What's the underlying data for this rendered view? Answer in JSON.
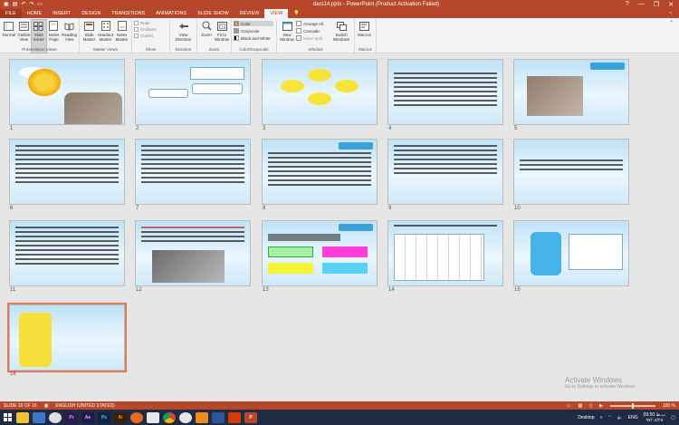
{
  "titlebar": {
    "title": "dars14.pptx - PowerPoint (Product Activation Failed)",
    "minimize": "—",
    "restore": "❐",
    "close": "✕"
  },
  "tabs": {
    "file": "FILE",
    "items": [
      "HOME",
      "INSERT",
      "DESIGN",
      "TRANSITIONS",
      "ANIMATIONS",
      "SLIDE SHOW",
      "REVIEW",
      "VIEW"
    ],
    "active": "VIEW"
  },
  "ribbon": {
    "presentation_views": {
      "label": "Presentation Views",
      "buttons": [
        "Normal",
        "Outline View",
        "Slide Sorter",
        "Notes Page",
        "Reading View"
      ]
    },
    "master_views": {
      "label": "Master Views",
      "buttons": [
        "Slide Master",
        "Handout Master",
        "Notes Master"
      ]
    },
    "show": {
      "label": "Show",
      "items": [
        "Ruler",
        "Gridlines",
        "Guides"
      ]
    },
    "direction": {
      "label": "Direction",
      "button": "View Direction"
    },
    "zoom": {
      "label": "Zoom",
      "buttons": [
        "Zoom",
        "Fit to Window"
      ]
    },
    "color": {
      "label": "Color/Grayscale",
      "items": [
        "Color",
        "Grayscale",
        "Black and White"
      ]
    },
    "window": {
      "label": "Window",
      "new_window": "New Window",
      "items": [
        "Arrange All",
        "Cascade",
        "Move Split"
      ],
      "switch": "Switch Windows"
    },
    "macros": {
      "label": "Macros",
      "button": "Macros"
    }
  },
  "slides": [
    {
      "num": "1"
    },
    {
      "num": "2"
    },
    {
      "num": "3"
    },
    {
      "num": "4"
    },
    {
      "num": "5"
    },
    {
      "num": "6"
    },
    {
      "num": "7"
    },
    {
      "num": "8"
    },
    {
      "num": "9"
    },
    {
      "num": "10"
    },
    {
      "num": "11"
    },
    {
      "num": "12"
    },
    {
      "num": "13"
    },
    {
      "num": "14"
    },
    {
      "num": "15"
    },
    {
      "num": "16"
    }
  ],
  "selected_slide": "16",
  "statusbar": {
    "slide_info": "SLIDE 16 OF 16",
    "language": "ENGLISH (UNITED STATES)",
    "zoom": "100 %"
  },
  "watermark": {
    "line1": "Activate Windows",
    "line2": "Go to Settings to activate Windows."
  },
  "taskbar": {
    "desktop": "Desktop",
    "lang": "ENG",
    "time": "09:50 ب.ظ",
    "date": "۹۷/۰۸/۲۸",
    "apps": [
      {
        "label": "Pr",
        "color": "#2a1a4e"
      },
      {
        "label": "Ae",
        "color": "#1f1a4e"
      },
      {
        "label": "Ps",
        "color": "#0e2540"
      },
      {
        "label": "Ai",
        "color": "#3a1f05"
      },
      {
        "label": "P",
        "color": "#b7472a"
      }
    ]
  }
}
